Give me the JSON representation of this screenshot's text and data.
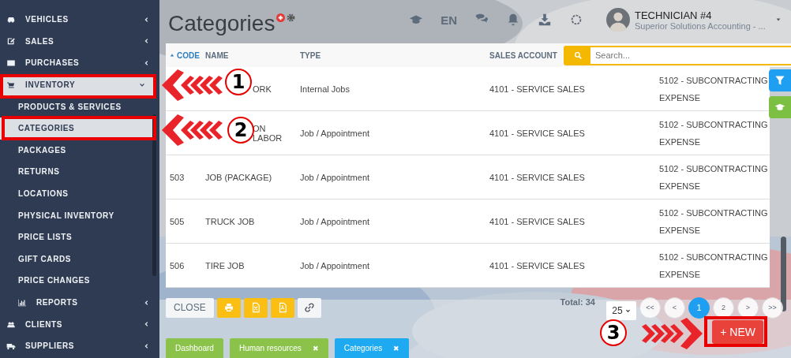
{
  "sidebar": {
    "items": [
      {
        "label": "VEHICLES",
        "kind": "main",
        "selected": false,
        "expanded": false
      },
      {
        "label": "SALES",
        "kind": "main",
        "selected": false,
        "expanded": false
      },
      {
        "label": "PURCHASES",
        "kind": "main",
        "selected": false,
        "expanded": false
      },
      {
        "label": "INVENTORY",
        "kind": "main",
        "selected": true,
        "expanded": true
      },
      {
        "label": "PRODUCTS & SERVICES",
        "kind": "sub",
        "selected": false
      },
      {
        "label": "CATEGORIES",
        "kind": "sub",
        "selected": true
      },
      {
        "label": "PACKAGES",
        "kind": "sub",
        "selected": false
      },
      {
        "label": "RETURNS",
        "kind": "sub",
        "selected": false
      },
      {
        "label": "LOCATIONS",
        "kind": "sub",
        "selected": false
      },
      {
        "label": "PHYSICAL INVENTORY",
        "kind": "sub",
        "selected": false
      },
      {
        "label": "PRICE LISTS",
        "kind": "sub",
        "selected": false
      },
      {
        "label": "GIFT CARDS",
        "kind": "sub",
        "selected": false
      },
      {
        "label": "PRICE CHANGES",
        "kind": "sub",
        "selected": false
      },
      {
        "label": "REPORTS",
        "kind": "subgroup",
        "selected": false,
        "expanded": false
      },
      {
        "label": "CLIENTS",
        "kind": "main",
        "selected": false,
        "expanded": false
      },
      {
        "label": "SUPPLIERS",
        "kind": "main",
        "selected": false,
        "expanded": false
      }
    ]
  },
  "header": {
    "title": "Categories",
    "language": "EN",
    "user": {
      "name": "TECHNICIAN #4",
      "company": "Superior Solutions Accounting - ..."
    }
  },
  "table": {
    "columns": [
      {
        "label": "CODE",
        "sorted": true
      },
      {
        "label": "NAME",
        "sorted": false
      },
      {
        "label": "TYPE",
        "sorted": false
      },
      {
        "label": "SALES ACCOUNT",
        "sorted": false
      }
    ],
    "search": {
      "placeholder": "Search..."
    },
    "rows": [
      {
        "name": "ORK",
        "type": "Internal Jobs",
        "sales_account": "4101 - SERVICE SALES",
        "column_5": "5102 - SUBCONTRACTING EXPENSE"
      },
      {
        "name": "ON\nLABOR",
        "type": "Job / Appointment",
        "sales_account": "4101 - SERVICE SALES",
        "column_5": "5102 - SUBCONTRACTING EXPENSE"
      },
      {
        "code": "503",
        "name": "JOB (PACKAGE)",
        "type": "Job / Appointment",
        "sales_account": "4101 - SERVICE SALES",
        "column_5": "5102 - SUBCONTRACTING EXPENSE"
      },
      {
        "code": "505",
        "name": "TRUCK JOB",
        "type": "Job / Appointment",
        "sales_account": "4101 - SERVICE SALES",
        "column_5": "5102 - SUBCONTRACTING EXPENSE"
      },
      {
        "code": "506",
        "name": "TIRE JOB",
        "type": "Job / Appointment",
        "sales_account": "4101 - SERVICE SALES",
        "column_5": "5102 - SUBCONTRACTING EXPENSE"
      }
    ]
  },
  "toolbar": {
    "close": "CLOSE"
  },
  "pagination": {
    "total": "Total: 34",
    "page_size": "25",
    "pages": [
      {
        "label": "<<",
        "selected": false
      },
      {
        "label": "<",
        "selected": false
      },
      {
        "label": "1",
        "selected": true
      },
      {
        "label": "2",
        "selected": false
      },
      {
        "label": ">",
        "selected": false
      },
      {
        "label": ">>",
        "selected": false
      }
    ]
  },
  "new_button": "+ NEW",
  "tabs": [
    {
      "label": "Dashboard",
      "selected": false
    },
    {
      "label": "Human resources",
      "close": "✖",
      "selected": false
    },
    {
      "label": "Categories",
      "close": "✖",
      "selected": true
    }
  ],
  "annotations": [
    {
      "number": "1"
    },
    {
      "number": "2"
    },
    {
      "number": "3"
    }
  ]
}
